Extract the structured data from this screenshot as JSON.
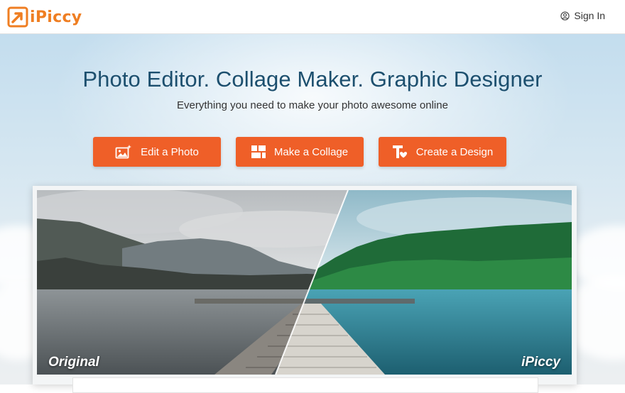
{
  "header": {
    "logo_text": "iPiccy",
    "sign_in": "Sign In",
    "icons": {
      "user": "user-circle-icon"
    }
  },
  "hero": {
    "headline": "Photo Editor. Collage Maker. Graphic Designer",
    "subhead": "Everything you need to make your photo awesome online"
  },
  "actions": [
    {
      "label": "Edit a Photo",
      "icon": "photo-sparkle-icon"
    },
    {
      "label": "Make a Collage",
      "icon": "collage-grid-icon"
    },
    {
      "label": "Create a Design",
      "icon": "text-design-icon"
    }
  ],
  "comparison": {
    "before_label": "Original",
    "after_label": "iPiccy"
  },
  "colors": {
    "brand_orange": "#ef7e22",
    "button_orange": "#ef5f28",
    "headline_blue": "#1c4f6e"
  }
}
